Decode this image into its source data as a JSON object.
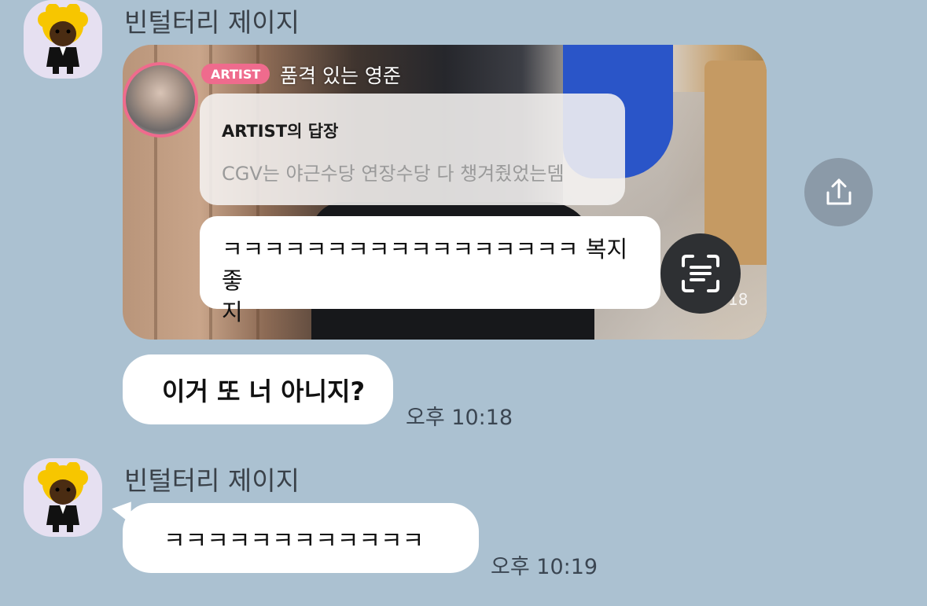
{
  "messages": {
    "group1": {
      "sender": "빈털터리 제이지",
      "avatar_icon": "character-avatar-icon",
      "card": {
        "badge": "ARTIST",
        "artist_name": "품격 있는 영준",
        "reply_title": "ARTIST의 답장",
        "reply_text": "CGV는 야근수당 연장수당 다 챙겨줬었는뎀",
        "comment_line1": "ㅋㅋㅋㅋㅋㅋㅋㅋㅋㅋㅋㅋㅋㅋㅋㅋㅋ 복지 좋",
        "comment_line2": "지",
        "number": "18"
      },
      "text": "이거 또 너 아니지?",
      "time": "오후 10:18"
    },
    "group2": {
      "sender": "빈털터리 제이지",
      "avatar_icon": "character-avatar-icon",
      "text": "ㅋㅋㅋㅋㅋㅋㅋㅋㅋㅋㅋㅋ",
      "time": "오후 10:19"
    }
  },
  "icons": {
    "share": "share-icon",
    "scan": "text-scan-icon"
  },
  "colors": {
    "background": "#abc1d1",
    "bubble": "#ffffff",
    "artist_badge": "#ef6b8d",
    "avatar_bg": "#e6e0f1"
  }
}
